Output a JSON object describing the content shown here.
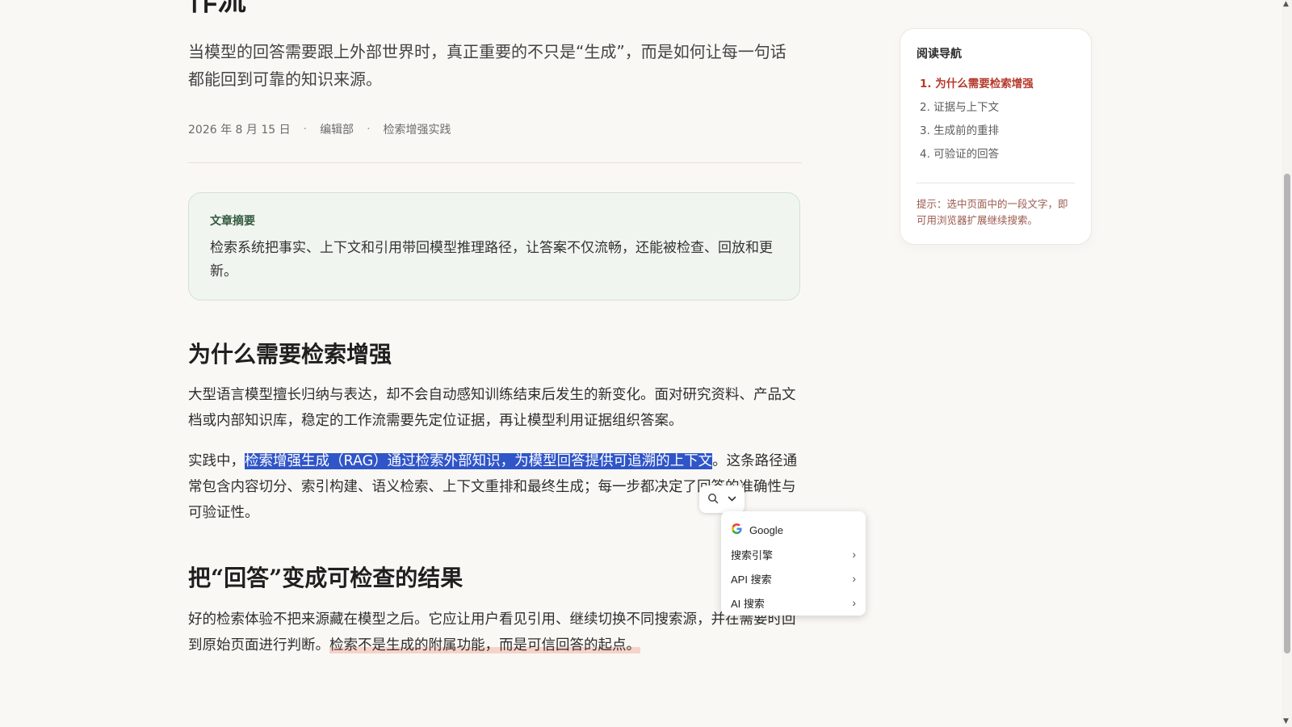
{
  "article": {
    "title_fragment": "作流",
    "lead": "当模型的回答需要跟上外部世界时，真正重要的不只是“生成”，而是如何让每一句话都能回到可靠的知识来源。",
    "meta": {
      "date": "2026 年 8 月 15 日",
      "author": "编辑部",
      "category": "检索增强实践",
      "separator": "·"
    },
    "summary": {
      "title": "文章摘要",
      "text": "检索系统把事实、上下文和引用带回模型推理路径，让答案不仅流畅，还能被检查、回放和更新。"
    },
    "section1": {
      "heading": "为什么需要检索增强",
      "p1": "大型语言模型擅长归纳与表达，却不会自动感知训练结束后发生的新变化。面对研究资料、产品文档或内部知识库，稳定的工作流需要先定位证据，再让模型利用证据组织答案。",
      "p2_before": "实践中，",
      "p2_selected": "检索增强生成（RAG）通过检索外部知识，为模型回答提供可追溯的上下文",
      "p2_after": "。这条路径通常包含内容切分、索引构建、语义检索、上下文重排和最终生成；每一步都决定了回答的准确性与可验证性。"
    },
    "section2": {
      "heading": "把“回答”变成可检查的结果",
      "p1_before": "好的检索体验不把来源藏在模型之后。它应让用户看见引用、继续切换不同搜索源，并在需要时回到原始页面进行判断。",
      "p1_highlight": "检索不是生成的附属功能，而是可信回答的起点。"
    }
  },
  "toc": {
    "title": "阅读导航",
    "items": [
      {
        "label": "1. 为什么需要检索增强",
        "active": true
      },
      {
        "label": "2. 证据与上下文",
        "active": false
      },
      {
        "label": "3. 生成前的重排",
        "active": false
      },
      {
        "label": "4. 可验证的回答",
        "active": false
      }
    ],
    "hint": "提示：选中页面中的一段文字，即可用浏览器扩展继续搜索。"
  },
  "selection_popup": {
    "toolbar_icons": [
      "search-icon",
      "chevron-down-icon"
    ],
    "menu": {
      "google_label": "Google",
      "items": [
        {
          "label": "搜索引擎"
        },
        {
          "label": "API 搜索"
        },
        {
          "label": "AI 搜索"
        }
      ]
    }
  },
  "colors": {
    "accent": "#b5392b",
    "selection": "#2f55c8",
    "highlight": "#f6d3c9",
    "summary_bg": "#f1f5ef"
  }
}
